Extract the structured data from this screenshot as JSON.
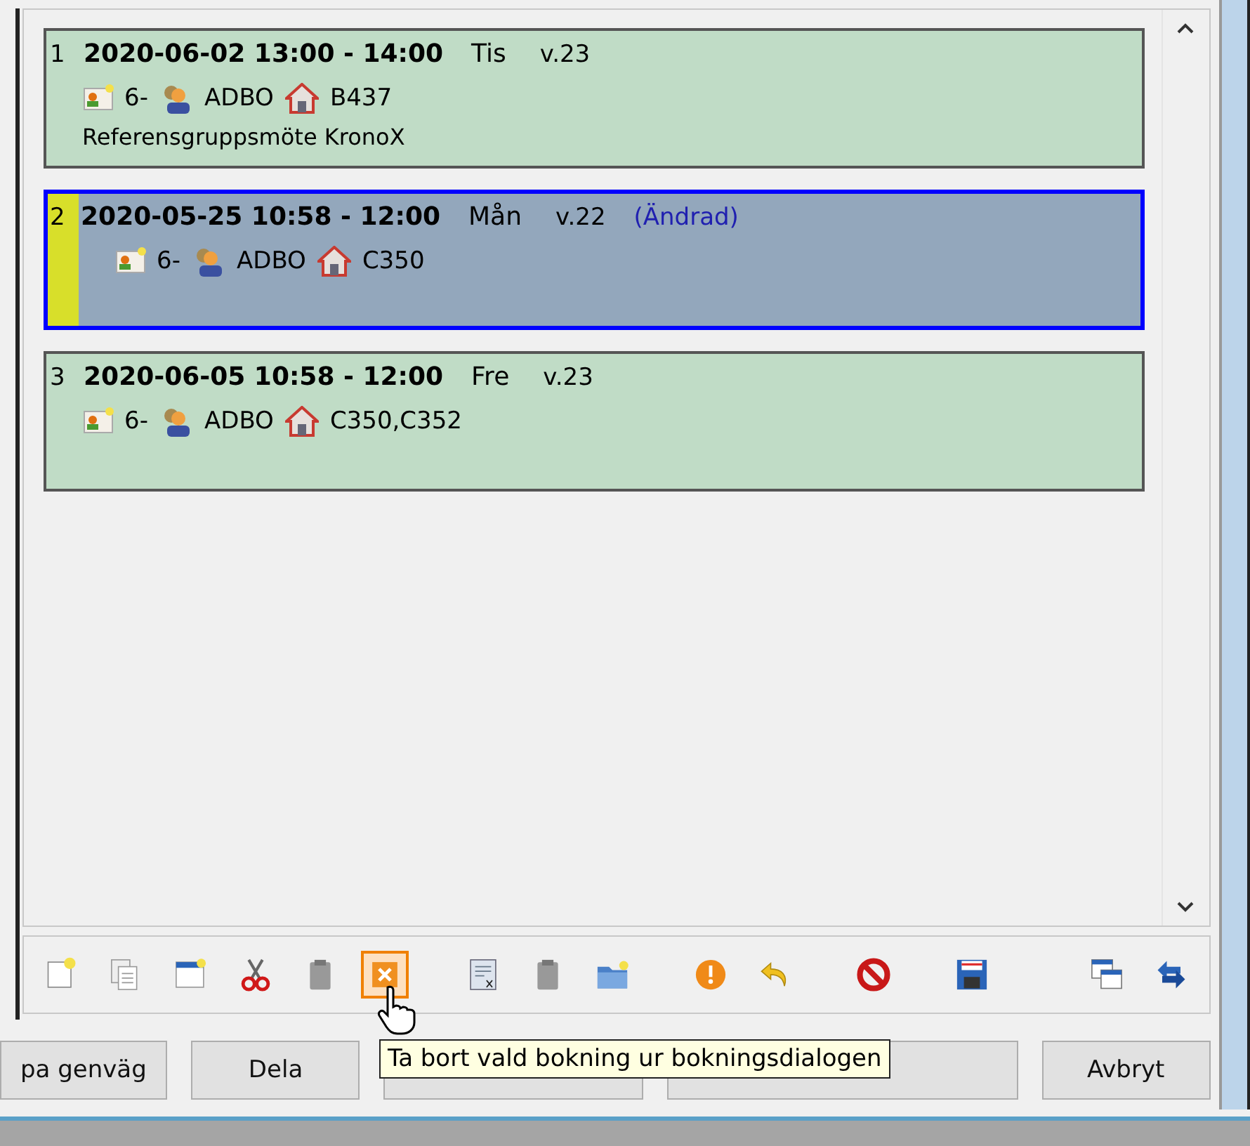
{
  "bookings": [
    {
      "number": "1",
      "datetime": "2020-06-02 13:00 - 14:00",
      "day": "Tis",
      "week": "v.23",
      "selected": false,
      "group": "6-",
      "person": "ADBO",
      "room": "B437",
      "description": "Referensgruppsmöte KronoX"
    },
    {
      "number": "2",
      "datetime": "2020-05-25 10:58 - 12:00",
      "day": "Mån",
      "week": "v.22",
      "note": "(Ändrad)",
      "selected": true,
      "group": "6-",
      "person": "ADBO",
      "room": "C350"
    },
    {
      "number": "3",
      "datetime": "2020-06-05 10:58 - 12:00",
      "day": "Fre",
      "week": "v.23",
      "selected": false,
      "group": "6-",
      "person": "ADBO",
      "room": "C350,C352"
    }
  ],
  "toolbar": [
    [
      {
        "kind": "new",
        "hovered": false
      },
      {
        "kind": "copy",
        "hovered": false
      },
      {
        "kind": "window",
        "hovered": false
      },
      {
        "kind": "cut",
        "hovered": false
      },
      {
        "kind": "paste",
        "hovered": false
      },
      {
        "kind": "delete",
        "hovered": true
      }
    ],
    [
      {
        "kind": "doc",
        "hovered": false
      },
      {
        "kind": "paste",
        "hovered": false
      },
      {
        "kind": "folder",
        "hovered": false
      }
    ],
    [
      {
        "kind": "warning",
        "hovered": false
      },
      {
        "kind": "undo",
        "hovered": false
      }
    ],
    [
      {
        "kind": "stop",
        "hovered": false
      }
    ],
    [
      {
        "kind": "save",
        "hovered": false
      }
    ],
    [
      {
        "kind": "windows",
        "hovered": false
      },
      {
        "kind": "sync",
        "hovered": false
      }
    ]
  ],
  "buttons": [
    {
      "kind": "text",
      "label": "pa genväg"
    },
    {
      "kind": "text",
      "label": "Dela"
    },
    {
      "kind": "blank"
    },
    {
      "kind": "blank"
    },
    {
      "kind": "text",
      "label": "Avbryt"
    }
  ],
  "tooltip": "Ta bort vald bokning ur bokningsdialogen"
}
